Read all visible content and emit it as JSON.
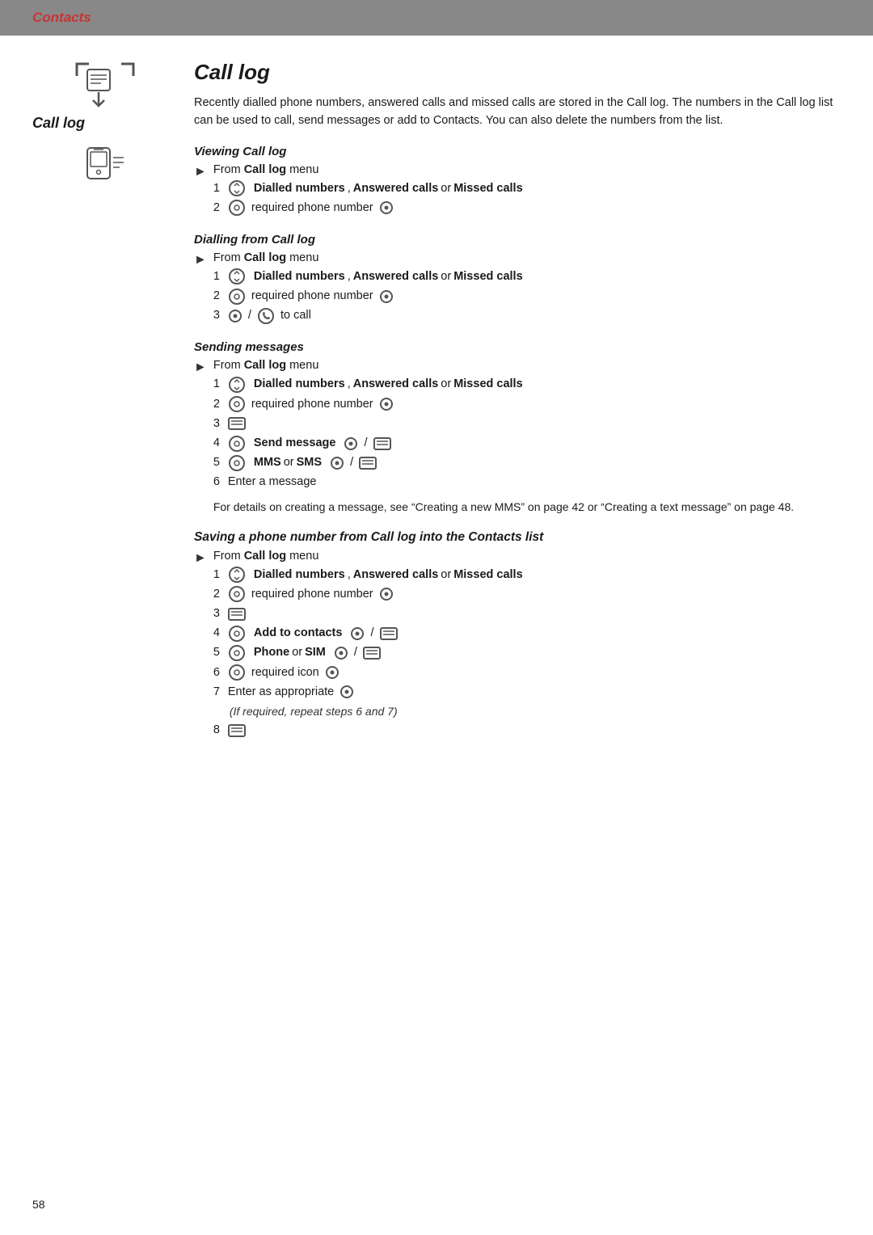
{
  "header": {
    "title": "Contacts"
  },
  "page": {
    "title": "Contacts",
    "section_title": "Call log",
    "intro": "Recently dialled phone numbers, answered calls and missed calls are stored in the Call log. The numbers in the Call log list can be used to call, send messages or add to Contacts. You can also delete the numbers from the list.",
    "sidebar": {
      "calllog_label": "Call log"
    },
    "sections": [
      {
        "id": "viewing",
        "title": "Viewing Call log",
        "from_label": "From",
        "from_bold": "Call log",
        "from_suffix": "menu",
        "steps": [
          {
            "num": "1",
            "parts": [
              "scroll-icon",
              " ",
              "bold:Dialled numbers",
              ", ",
              "bold:Answered calls",
              " or ",
              "bold:Missed calls"
            ]
          },
          {
            "num": "2",
            "parts": [
              "nav-icon",
              " required phone number ",
              "center-icon"
            ]
          }
        ]
      },
      {
        "id": "dialling",
        "title": "Dialling from Call log",
        "from_label": "From",
        "from_bold": "Call log",
        "from_suffix": "menu",
        "steps": [
          {
            "num": "1",
            "parts": [
              "scroll-icon",
              " ",
              "bold:Dialled numbers",
              ", ",
              "bold:Answered calls",
              " or ",
              "bold:Missed calls"
            ]
          },
          {
            "num": "2",
            "parts": [
              "nav-icon",
              " required phone number ",
              "center-icon"
            ]
          },
          {
            "num": "3",
            "parts": [
              "center-icon",
              " / ",
              "call-icon",
              " to call"
            ]
          }
        ]
      },
      {
        "id": "sending",
        "title": "Sending messages",
        "from_label": "From",
        "from_bold": "Call log",
        "from_suffix": "menu",
        "steps": [
          {
            "num": "1",
            "parts": [
              "scroll-icon",
              " ",
              "bold:Dialled numbers",
              ", ",
              "bold:Answered calls",
              " or ",
              "bold:Missed calls"
            ]
          },
          {
            "num": "2",
            "parts": [
              "nav-icon",
              " required phone number ",
              "center-icon"
            ]
          },
          {
            "num": "3",
            "parts": [
              "menu-icon"
            ]
          },
          {
            "num": "4",
            "parts": [
              "nav-icon",
              " ",
              "bold:Send message",
              " ",
              "center-icon",
              " / ",
              "menu-icon"
            ]
          },
          {
            "num": "5",
            "parts": [
              "nav-icon",
              " ",
              "bold:MMS",
              " or ",
              "bold:SMS",
              " ",
              "center-icon",
              " / ",
              "menu-icon"
            ]
          },
          {
            "num": "6",
            "parts": [
              "text:Enter a message"
            ]
          }
        ],
        "note": "For details on creating a message, see \"Creating a new MMS\" on page 42 or \"Creating a text message\" on page 48."
      },
      {
        "id": "saving",
        "title": "Saving a phone number from Call log into the Contacts list",
        "from_label": "From",
        "from_bold": "Call log",
        "from_suffix": "menu",
        "steps": [
          {
            "num": "1",
            "parts": [
              "scroll-icon",
              " ",
              "bold:Dialled numbers",
              ", ",
              "bold:Answered calls",
              " or ",
              "bold:Missed calls"
            ]
          },
          {
            "num": "2",
            "parts": [
              "nav-icon",
              " required phone number ",
              "center-icon"
            ]
          },
          {
            "num": "3",
            "parts": [
              "menu-icon"
            ]
          },
          {
            "num": "4",
            "parts": [
              "nav-icon",
              " ",
              "bold:Add to contacts",
              " ",
              "center-icon",
              " / ",
              "menu-icon"
            ]
          },
          {
            "num": "5",
            "parts": [
              "nav-icon",
              " ",
              "bold:Phone",
              " or ",
              "bold:SIM",
              " ",
              "center-icon",
              " / ",
              "menu-icon"
            ]
          },
          {
            "num": "6",
            "parts": [
              "nav-icon",
              " required icon ",
              "center-icon"
            ]
          },
          {
            "num": "7",
            "parts": [
              "text:Enter as appropriate ",
              "center-icon"
            ]
          },
          {
            "num": "sub",
            "parts": [
              "text:(If required, repeat steps 6 and 7)"
            ]
          },
          {
            "num": "8",
            "parts": [
              "menu-icon"
            ]
          }
        ]
      }
    ],
    "page_number": "58"
  }
}
